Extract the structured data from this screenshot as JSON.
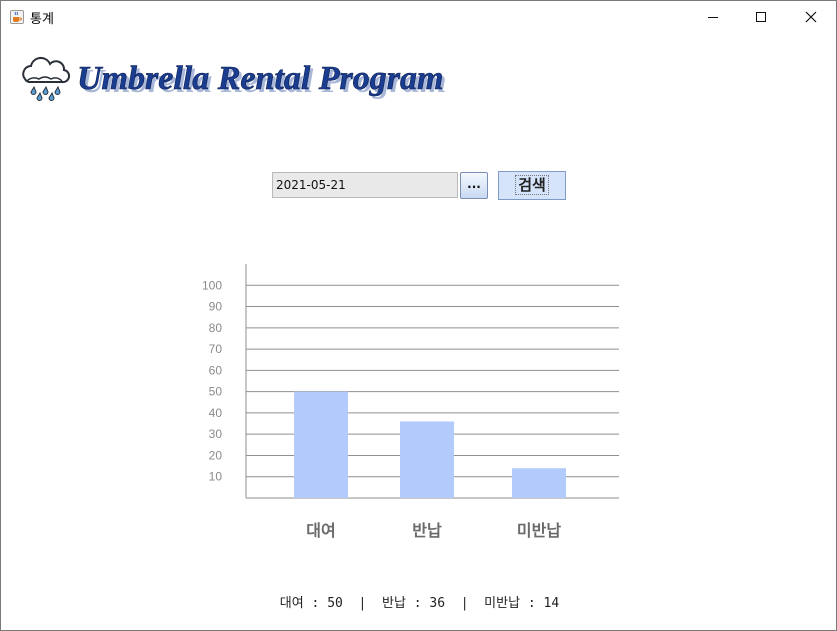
{
  "window": {
    "title": "통계",
    "icon": "java-cup-icon",
    "controls": {
      "minimize": "minimize-icon",
      "maximize": "maximize-icon",
      "close": "close-icon"
    }
  },
  "header": {
    "logo_text": "Umbrella Rental Program",
    "logo_icon": "rain-cloud-icon",
    "logo_color": "#1a3d8f"
  },
  "search": {
    "date_value": "2021-05-21",
    "picker_label": "...",
    "button_label": "검색"
  },
  "chart_data": {
    "type": "bar",
    "categories": [
      "대여",
      "반납",
      "미반납"
    ],
    "values": [
      50,
      36,
      14
    ],
    "yticks": [
      10,
      20,
      30,
      40,
      50,
      60,
      70,
      80,
      90,
      100
    ],
    "ylim": [
      0,
      110
    ],
    "grid": true,
    "bar_color": "#b3cbfc",
    "title": "",
    "xlabel": "",
    "ylabel": ""
  },
  "summary": {
    "text": "대여 : 50  |  반납 : 36  |  미반납 : 14"
  }
}
